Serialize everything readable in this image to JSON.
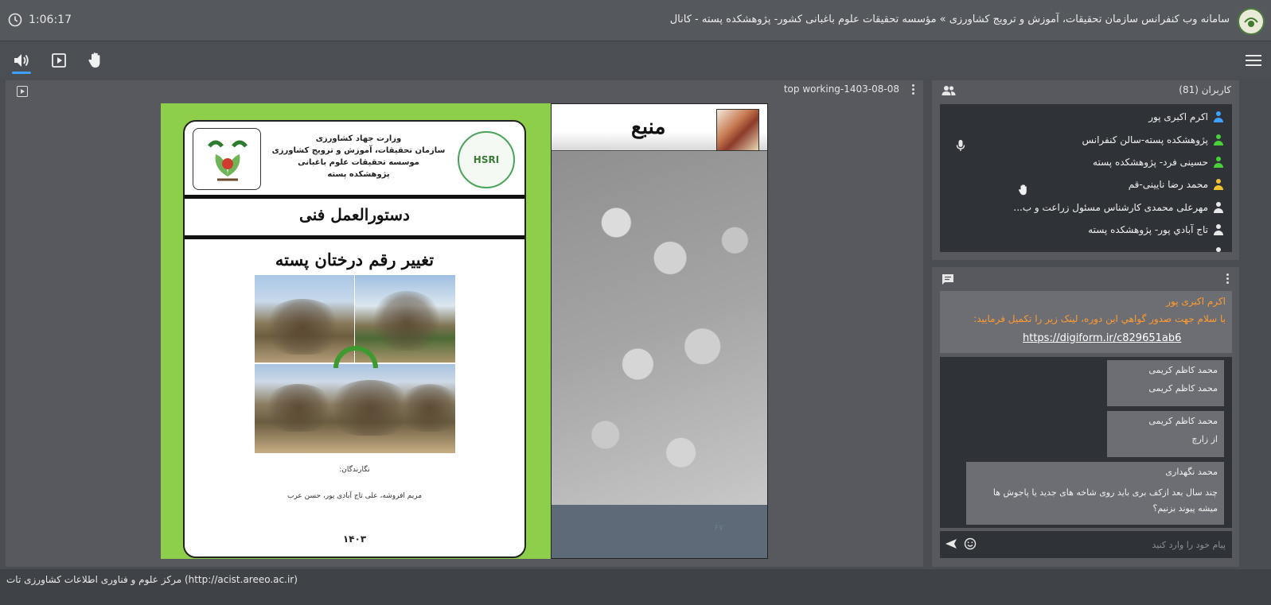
{
  "header": {
    "timer": "1:06:17",
    "title": "سامانه وب کنفرانس سازمان تحقیقات، آموزش و ترویج کشاورزی » مؤسسه تحقیقات علوم باغبانی کشور- پژوهشکده پسته - کانال"
  },
  "toolbar": {
    "icons": [
      "speaker-icon",
      "play-icon",
      "raise-hand-icon",
      "menu-icon"
    ],
    "accent": "#3ea0ff"
  },
  "presentation": {
    "file_label": "top working-1403-08-08"
  },
  "slide": {
    "ministry_lines": [
      "وزارت جهاد کشاورزی",
      "سازمان تحقیقات، آموزش و ترویج کشاورزی",
      "موسسه تحقیقات علوم باغبانی",
      "پژوهشکده پسته"
    ],
    "logo_text": "HSRI",
    "doc_type": "دستورالعمل فنی",
    "doc_title": "تغییر رقم درختان پسته",
    "authors_label": "نگارندگان:",
    "authors": "مریم افروشه، علی تاج آبادی پور، حسن عرب",
    "year": "۱۴۰۳",
    "source_title": "منبع",
    "page_number": "۶۷"
  },
  "users": {
    "header": "کاربران (81)",
    "list": [
      {
        "name": "اکرم اکبری پور",
        "color": "#3ea0ff"
      },
      {
        "name": "پژوهشکده پسته-سالن کنفرانس",
        "color": "#49d13a"
      },
      {
        "name": "حسینی فرد- پژوهشکده پسته",
        "color": "#49d13a"
      },
      {
        "name": "محمد رضا نایینی-قم",
        "color": "#f2c230"
      },
      {
        "name": "مهرعلی محمدی کارشناس مسئول زراعت و ب...",
        "color": "#e8e8e8"
      },
      {
        "name": "تاج آبادي پور- پژوهشکده پسته",
        "color": "#e8e8e8"
      }
    ]
  },
  "chat": {
    "pinned": {
      "name": "اکرم اکبری پور",
      "text": "با سلام جهت صدور گواهي این دوره، لینک زیر را تکمیل فرمایید:",
      "link": "https://digiform.ir/c829651ab6"
    },
    "messages": [
      {
        "name": "محمد کاظم کریمی",
        "text": "محمد کاظم کریمی"
      },
      {
        "name": "محمد کاظم کریمی",
        "text": "از زارچ"
      },
      {
        "name": "محمد نگهداری",
        "text": "چند سال بعد ازکف بری باید روی شاخه های جدید یا پاجوش ها میشه پیوند بزنیم؟"
      }
    ],
    "input_placeholder": "پیام خود را وارد کنید"
  },
  "footer": {
    "text": "مرکز علوم و فناوری اطلاعات کشاورزی تات (http://acist.areeo.ac.ir)"
  }
}
